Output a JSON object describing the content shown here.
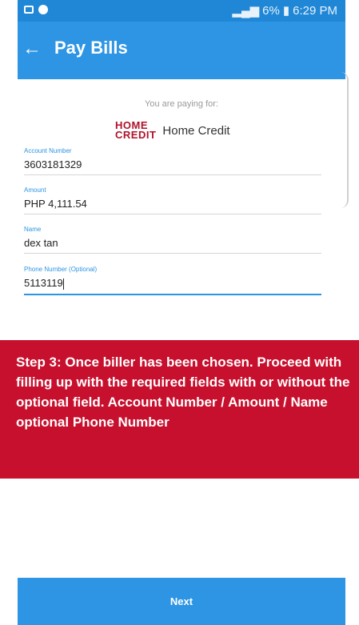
{
  "status_bar": {
    "signal": "☷ . ıl",
    "battery": "6%",
    "time": "6:29 PM"
  },
  "app_bar": {
    "title": "Pay Bills",
    "back_icon": "arrow-left-icon"
  },
  "biller": {
    "paying_for_label": "You are paying for:",
    "logo_line1": "HOME",
    "logo_line2": "CREDIT",
    "name": "Home Credit"
  },
  "form": {
    "fields": [
      {
        "label": "Account Number",
        "value": "3603181329"
      },
      {
        "label": "Amount",
        "value": "PHP 4,111.54"
      },
      {
        "label": "Name",
        "value": "dex tan"
      },
      {
        "label": "Phone Number (Optional)",
        "value": "5113119"
      }
    ]
  },
  "instruction": {
    "text": "Step 3: Once biller has been chosen. Proceed with filling up with the required fields with or without the optional field. Account Number / Amount / Name optional Phone Number"
  },
  "next_button": {
    "label": "Next"
  },
  "colors": {
    "primary_blue": "#2d95e3",
    "status_blue": "#1f87d6",
    "banner_red": "#c7102e",
    "logo_red": "#b0122a"
  }
}
